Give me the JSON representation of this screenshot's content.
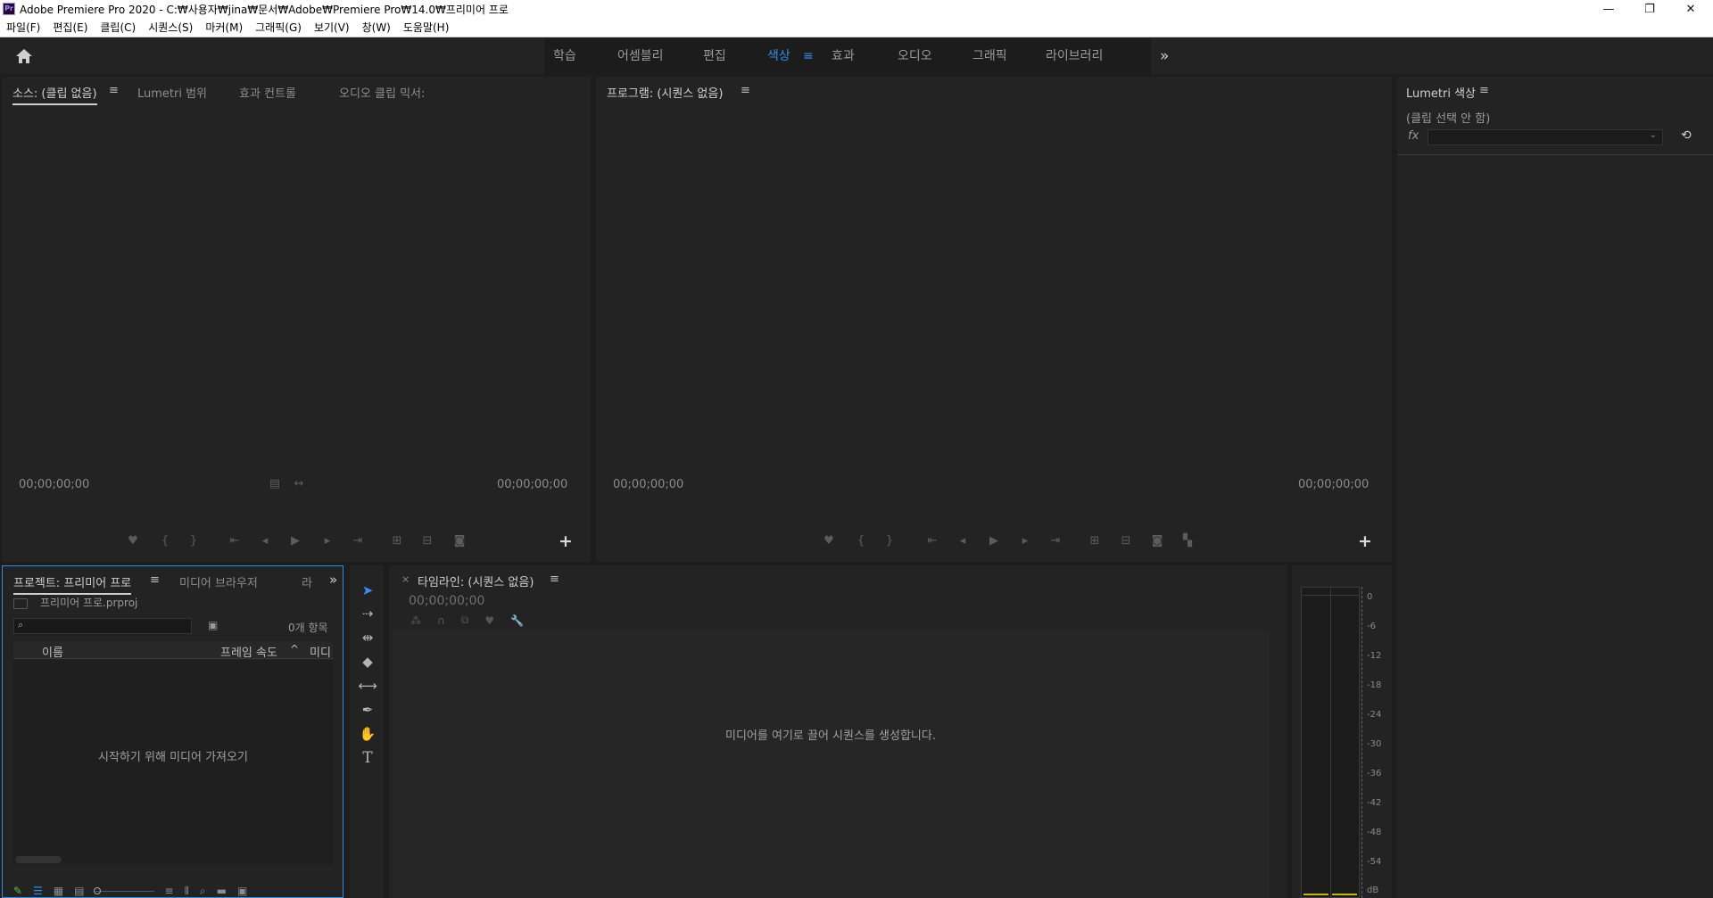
{
  "window": {
    "app_icon": "Pr",
    "title": "Adobe Premiere Pro 2020 - C:₩사용자₩jina₩문서₩Adobe₩Premiere Pro₩14.0₩프리미어 프로",
    "minimize": "—",
    "restore": "❐",
    "close": "✕"
  },
  "menu": [
    "파일(F)",
    "편집(E)",
    "클립(C)",
    "시퀀스(S)",
    "마커(M)",
    "그래픽(G)",
    "보기(V)",
    "창(W)",
    "도움말(H)"
  ],
  "header": {
    "home_icon": "home-icon",
    "workspaces": [
      "학습",
      "어셈블리",
      "편집",
      "색상",
      "효과",
      "오디오",
      "그래픽",
      "라이브러리"
    ],
    "active_workspace": "색상",
    "menu_glyph": "≡",
    "more_glyph": "»",
    "accent_color": "#2d8ceb"
  },
  "source_panel": {
    "tabs": [
      "소스: (클립 없음)",
      "Lumetri 범위",
      "효과 컨트롤",
      "오디오 클립 믹서:"
    ],
    "menu_glyph": "≡",
    "timecode_left": "00;00;00;00",
    "timecode_right": "00;00;00;00",
    "add_glyph": "+"
  },
  "program_panel": {
    "title": "프로그램: (시퀀스 없음)",
    "menu_glyph": "≡",
    "timecode_left": "00;00;00;00",
    "timecode_right": "00;00;00;00",
    "add_glyph": "+"
  },
  "lumetri_panel": {
    "title": "Lumetri 색상",
    "menu_glyph": "≡",
    "status": "(클립 선택 안 함)",
    "fx_label": "fx",
    "dropdown_value": "",
    "reset_glyph": "⟲"
  },
  "project_panel": {
    "tabs": [
      "프로젝트: 프리미어 프로",
      "미디어 브라우저",
      "라"
    ],
    "menu_glyph": "≡",
    "more_glyph": "»",
    "project_file": "프리미어 프로.prproj",
    "search_placeholder": "",
    "item_count": "0개 항목",
    "columns": [
      "이름",
      "프레임 속도",
      "미디"
    ],
    "empty_message": "시작하기 위해 미디어 가져오기"
  },
  "tools": [
    "selection-tool",
    "track-select-tool",
    "ripple-edit-tool",
    "razor-tool",
    "slip-tool",
    "pen-tool",
    "hand-tool",
    "type-tool"
  ],
  "timeline_panel": {
    "close_glyph": "×",
    "title": "타임라인: (시퀀스 없음)",
    "menu_glyph": "≡",
    "timecode": "00;00;00;00",
    "empty_message": "미디어를 여기로 끌어 시퀀스를 생성합니다."
  },
  "audio_meter": {
    "ticks": [
      "0",
      "-6",
      "-12",
      "-18",
      "-24",
      "-30",
      "-36",
      "-42",
      "-48",
      "-54",
      "dB"
    ]
  }
}
